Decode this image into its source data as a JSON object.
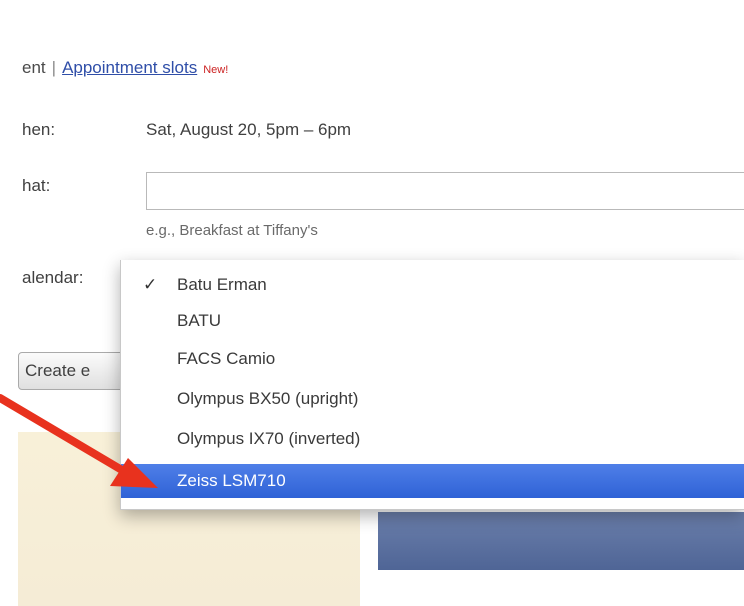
{
  "header": {
    "left_fragment": "ent",
    "separator": "|",
    "link_label": "Appointment slots",
    "new_badge": "New!"
  },
  "form": {
    "when_label": "hen:",
    "when_value": "Sat, August 20, 5pm – 6pm",
    "what_label": "hat:",
    "what_value": "",
    "hint": "e.g., Breakfast at Tiffany's",
    "calendar_label": "alendar:",
    "create_label": "Create e"
  },
  "dropdown": {
    "items": [
      {
        "label": "Batu Erman",
        "checked": true
      },
      {
        "label": "BATU",
        "checked": false
      },
      {
        "label": "FACS Camio",
        "checked": false
      },
      {
        "label": "Olympus BX50 (upright)",
        "checked": false
      },
      {
        "label": "Olympus IX70 (inverted)",
        "checked": false
      },
      {
        "label": "Zeiss LSM710",
        "checked": false,
        "selected": true
      }
    ],
    "check_glyph": "✓"
  },
  "colors": {
    "selection_blue": "#3366dd",
    "annotation_red": "#e8321e",
    "link_blue": "#2f4ea8"
  },
  "icons": {
    "annotation": "arrow-icon",
    "checkmark": "checkmark-icon"
  }
}
